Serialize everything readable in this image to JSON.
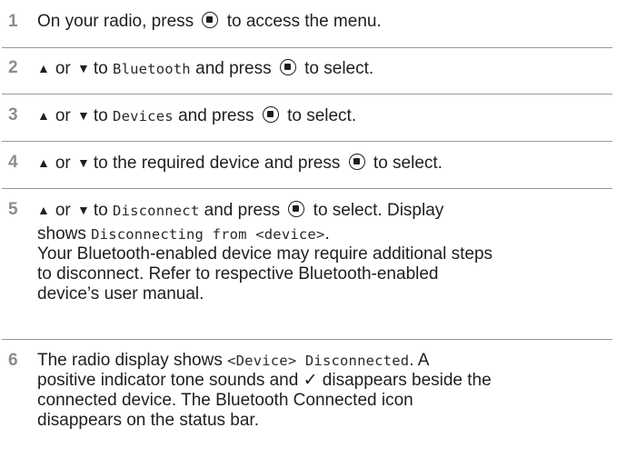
{
  "steps": [
    {
      "num": "1",
      "parts": [
        "On your radio, press",
        "to access the menu."
      ]
    },
    {
      "num": "2",
      "or": "or",
      "to": "to",
      "item": "Bluetooth",
      "and_press": "and press",
      "tail": "to select."
    },
    {
      "num": "3",
      "or": "or",
      "to": "to",
      "item": "Devices",
      "and_press": "and press",
      "tail": "to select."
    },
    {
      "num": "4",
      "or": "or",
      "text": "to the required device and press",
      "tail": "to select."
    },
    {
      "num": "5",
      "or": "or",
      "to": "to",
      "item": "Disconnect",
      "and_press": "and press",
      "tail": "to select. Display",
      "line2_prefix": "shows",
      "line2_mono": "Disconnecting from <device>",
      "line2_suffix": ".",
      "note_lines": [
        "Your Bluetooth-enabled device may require additional steps",
        "to disconnect. Refer to respective Bluetooth-enabled",
        "device’s user manual."
      ]
    },
    {
      "num": "6",
      "line1_prefix": "The radio display shows",
      "line1_mono": "<Device> Disconnected",
      "line1_suffix": ". A",
      "lines": [
        "positive indicator tone sounds and ✓ disappears beside the",
        "connected device. The Bluetooth Connected icon",
        "disappears on the status bar."
      ]
    }
  ],
  "icons": {
    "menu_ok": "menu-ok-button-icon",
    "up": "▲",
    "down": "▼"
  }
}
